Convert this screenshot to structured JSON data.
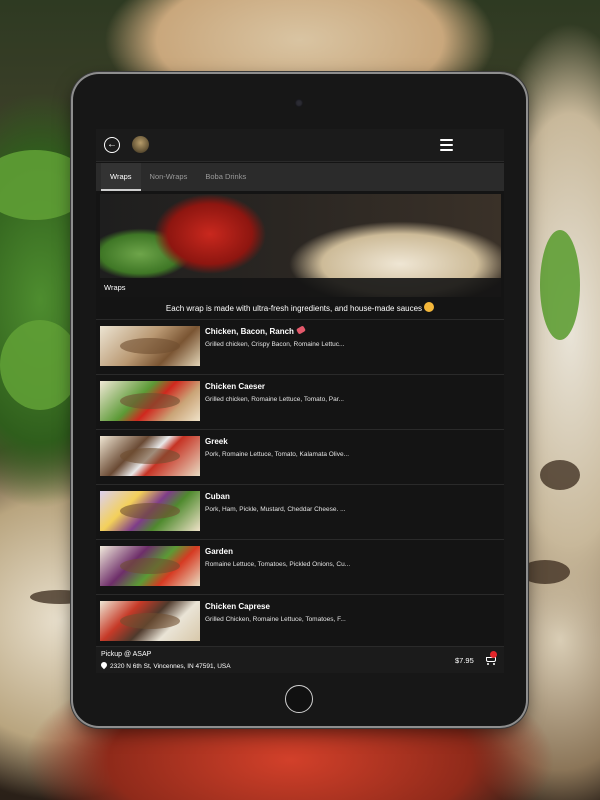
{
  "header": {
    "back_icon": "back-arrow-icon",
    "logo_icon": "restaurant-logo",
    "menu_icon": "hamburger-menu-icon"
  },
  "tabs": [
    {
      "label": "Wraps",
      "active": true
    },
    {
      "label": "Non-Wraps",
      "active": false
    },
    {
      "label": "Boba Drinks",
      "active": false
    }
  ],
  "hero": {
    "caption": "Wraps"
  },
  "tagline": "Each wrap is made with ultra-fresh ingredients, and house-made sauces",
  "items": [
    {
      "name": "Chicken, Bacon, Ranch",
      "desc": "Grilled chicken, Crispy Bacon, Romaine Lettuc...",
      "tag_icon": "pepper-icon"
    },
    {
      "name": "Chicken Caeser",
      "desc": "Grilled chicken, Romaine Lettuce, Tomato, Par..."
    },
    {
      "name": "Greek",
      "desc": "Pork, Romaine Lettuce, Tomato, Kalamata Olive..."
    },
    {
      "name": "Cuban",
      "desc": "Pork, Ham, Pickle, Mustard, Cheddar Cheese. ..."
    },
    {
      "name": "Garden",
      "desc": "Romaine Lettuce, Tomatoes, Pickled Onions, Cu..."
    },
    {
      "name": "Chicken Caprese",
      "desc": "Grilled Chicken, Romaine Lettuce, Tomatoes, F..."
    }
  ],
  "footer": {
    "pickup": "Pickup @ ASAP",
    "address": "2320 N 6th St, Vincennes, IN 47591, USA",
    "price": "$7.95",
    "cart_icon": "shopping-cart-icon"
  },
  "colors": {
    "screen_bg": "#141414",
    "tab_bar": "#2b2b2b",
    "cart_badge": "#e2262b"
  }
}
